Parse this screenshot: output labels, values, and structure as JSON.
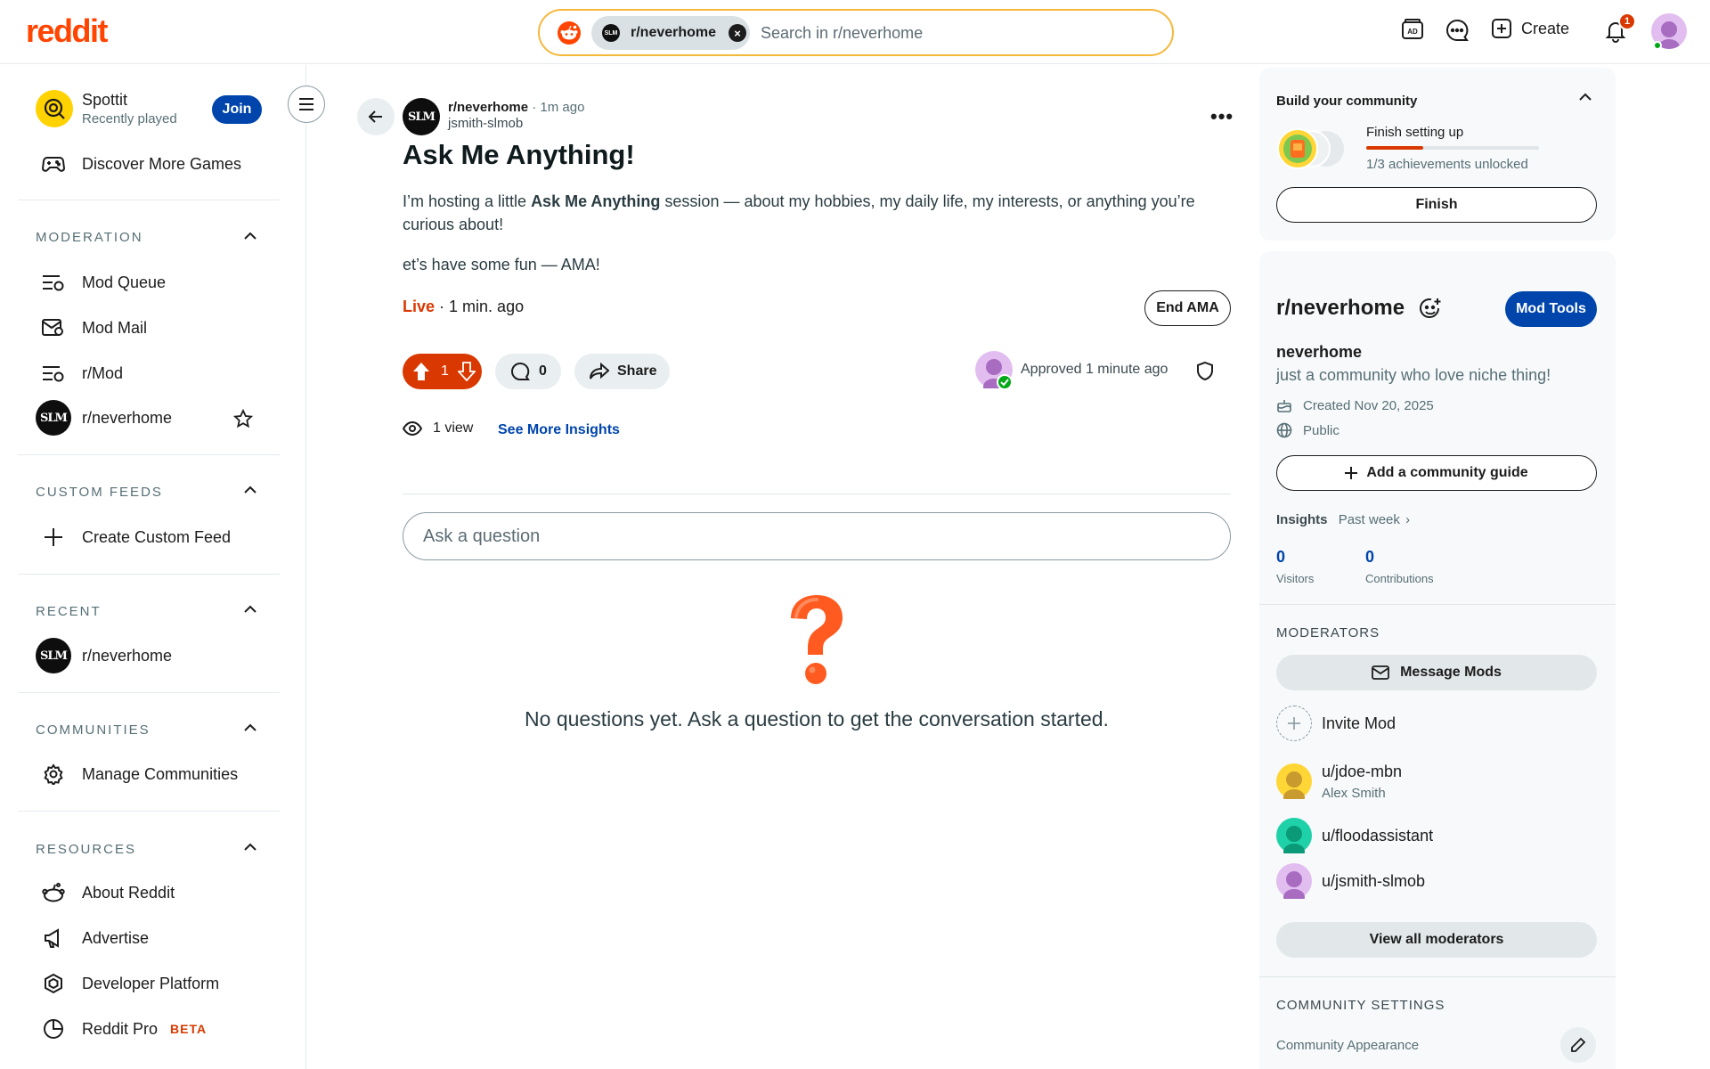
{
  "header": {
    "logo_text": "reddit",
    "search_chip_label": "r/neverhome",
    "search_chip_avatar_text": "SLM",
    "search_placeholder": "Search in r/neverhome",
    "create_label": "Create",
    "notification_count": "1"
  },
  "sidebar": {
    "spottit_title": "Spottit",
    "spottit_subtitle": "Recently played",
    "join_label": "Join",
    "discover_games": "Discover More Games",
    "moderation_heading": "MODERATION",
    "mod_queue": "Mod Queue",
    "mod_mail": "Mod Mail",
    "r_mod": "r/Mod",
    "mod_sub": "r/neverhome",
    "custom_feeds_heading": "CUSTOM FEEDS",
    "create_custom_feed": "Create Custom Feed",
    "recent_heading": "RECENT",
    "recent_sub": "r/neverhome",
    "communities_heading": "COMMUNITIES",
    "manage_communities": "Manage Communities",
    "resources_heading": "RESOURCES",
    "about_reddit": "About Reddit",
    "advertise": "Advertise",
    "developer_platform": "Developer Platform",
    "reddit_pro": "Reddit Pro",
    "beta": "BETA",
    "sub_avatar_text": "SLM"
  },
  "post": {
    "subreddit": "r/neverhome",
    "time": "1m ago",
    "author": "jsmith-slmob",
    "title": "Ask Me Anything!",
    "body_part1": "I’m hosting a little ",
    "body_bold": "Ask Me Anything",
    "body_part2": " session — about my hobbies, my daily life, my interests, or anything you’re curious about!",
    "body_para2": "et’s have some fun — AMA!",
    "live_label": "Live",
    "live_time": "· 1 min. ago",
    "end_ama": "End AMA",
    "votes": "1",
    "comments": "0",
    "share": "Share",
    "approved": "Approved 1 minute ago",
    "views": "1 view",
    "see_more_insights": "See More Insights",
    "ask_placeholder": "Ask a question",
    "empty_message": "No questions yet. Ask a question to get the conversation started."
  },
  "right_panel": {
    "build_heading": "Build your community",
    "finish_setting_up": "Finish setting up",
    "achievements": "1/3 achievements unlocked",
    "achievement_progress": 0.33,
    "finish_button": "Finish",
    "community_name": "r/neverhome",
    "mod_tools": "Mod Tools",
    "display_name": "neverhome",
    "description": "just a community who love niche thing!",
    "created": "Created Nov 20, 2025",
    "visibility": "Public",
    "add_guide": "Add a community guide",
    "insights_label": "Insights",
    "insights_range": "Past week",
    "visitors_count": "0",
    "visitors_label": "Visitors",
    "contributions_count": "0",
    "contributions_label": "Contributions",
    "moderators_heading": "MODERATORS",
    "message_mods": "Message Mods",
    "invite_mod": "Invite Mod",
    "mods": [
      {
        "name": "u/jdoe-mbn",
        "sub": "Alex Smith",
        "color": "#ffd635"
      },
      {
        "name": "u/floodassistant",
        "sub": "",
        "color": "#1fd1a8"
      },
      {
        "name": "u/jsmith-slmob",
        "sub": "",
        "color": "#d9a6ee"
      }
    ],
    "view_all_mods": "View all moderators",
    "community_settings_heading": "COMMUNITY SETTINGS",
    "community_appearance": "Community Appearance"
  },
  "colors": {
    "brand": "#ff4500",
    "upvote": "#d93900",
    "link_blue": "#0045ac",
    "search_border": "#f5b83b"
  }
}
